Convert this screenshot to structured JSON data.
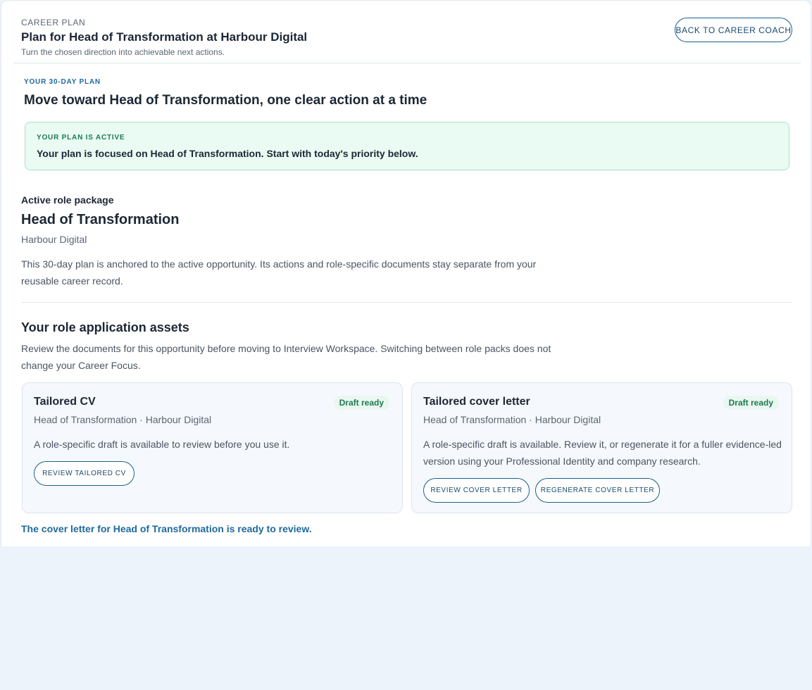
{
  "header": {
    "eyebrow": "CAREER PLAN",
    "title": "Plan for Head of Transformation at Harbour Digital",
    "subtitle": "Turn the chosen direction into achievable next actions.",
    "back_button_label": "BACK TO CAREER COACH"
  },
  "plan": {
    "eyebrow": "YOUR 30-DAY PLAN",
    "heading": "Move toward Head of Transformation, one clear action at a time",
    "banner": {
      "eyebrow": "YOUR PLAN IS ACTIVE",
      "text": "Your plan is focused on Head of Transformation. Start with today's priority below."
    }
  },
  "role_package": {
    "label": "Active role package",
    "title": "Head of Transformation",
    "company": "Harbour Digital",
    "description": "This 30-day plan is anchored to the active opportunity. Its actions and role-specific documents stay separate from your reusable career record."
  },
  "assets": {
    "title": "Your role application assets",
    "description": "Review the documents for this opportunity before moving to Interview Workspace. Switching between role packs does not change your Career Focus.",
    "cards": [
      {
        "title": "Tailored CV",
        "badge": "Draft ready",
        "meta": "Head of Transformation · Harbour Digital",
        "description": "A role-specific draft is available to review before you use it.",
        "buttons": [
          "REVIEW TAILORED CV"
        ]
      },
      {
        "title": "Tailored cover letter",
        "badge": "Draft ready",
        "meta": "Head of Transformation · Harbour Digital",
        "description": "A role-specific draft is available. Review it, or regenerate it for a fuller evidence-led version using your Professional Identity and company research.",
        "buttons": [
          "REVIEW COVER LETTER",
          "REGENERATE COVER LETTER"
        ]
      }
    ],
    "status_message": "The cover letter for Head of Transformation is ready to review."
  },
  "colors": {
    "accent": "#1e5f8f",
    "success": "#1b7a53",
    "background": "#edf3fb"
  }
}
